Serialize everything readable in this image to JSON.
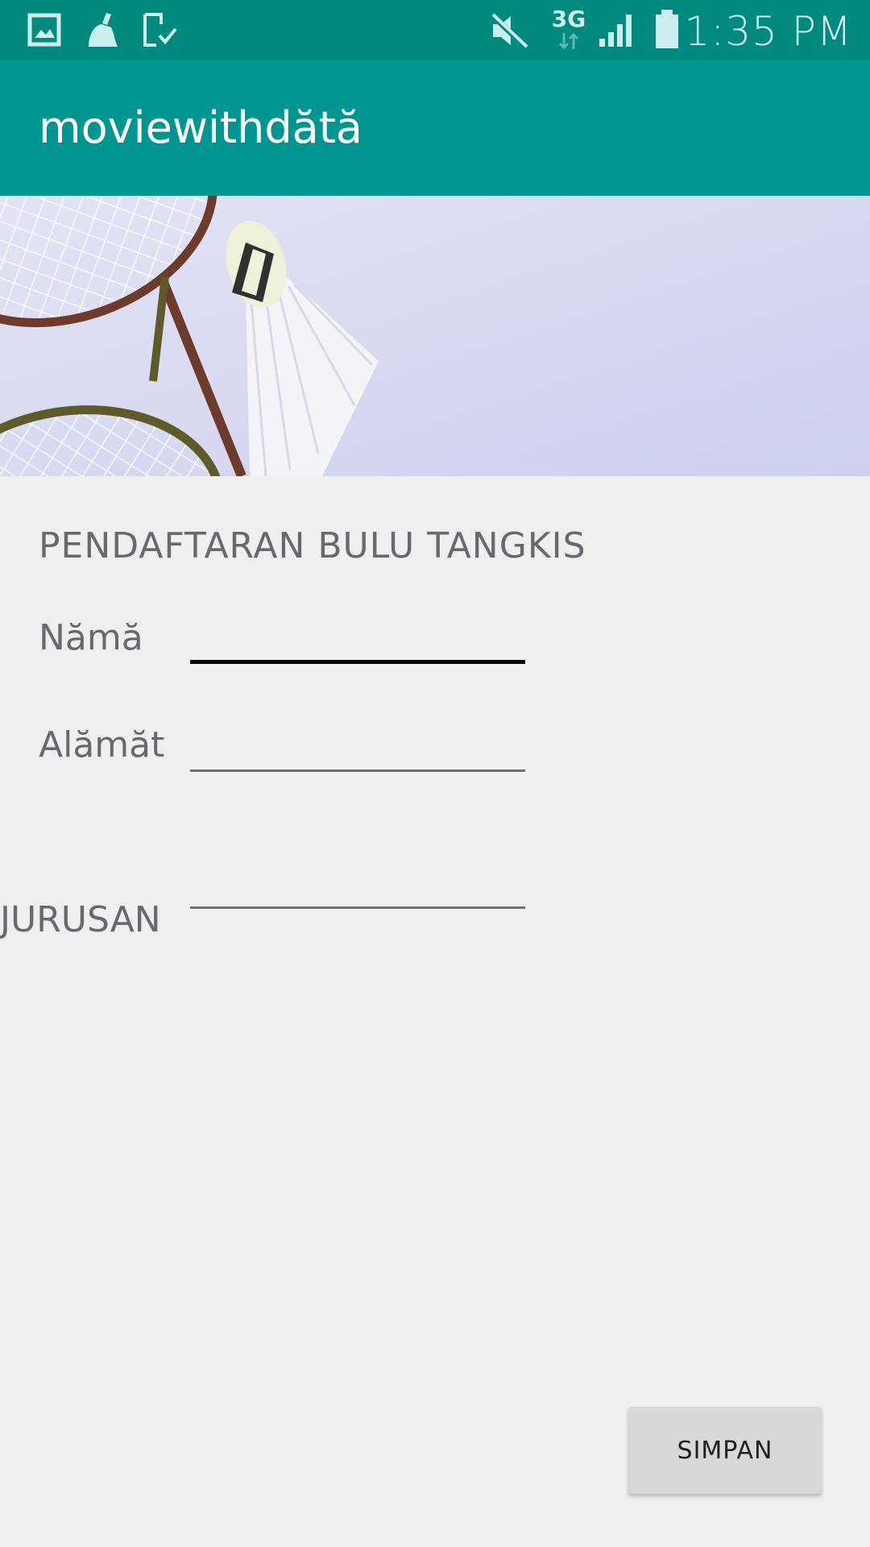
{
  "status_bar": {
    "time": "1:35 PM",
    "network": "3G",
    "icons": [
      "gallery-icon",
      "cleaner-icon",
      "download-done-icon",
      "mute-icon",
      "network-3g-icon",
      "signal-icon",
      "battery-icon"
    ]
  },
  "app_bar": {
    "title": "moviewithdătă",
    "color": "#009590"
  },
  "banner": {
    "background": "#d6d8ef",
    "subject": "badminton rackets and shuttlecock"
  },
  "form": {
    "title": "PENDAFTARAN BULU TANGKIS",
    "fields": [
      {
        "label": "Nămă",
        "value": "",
        "focused": true
      },
      {
        "label": "Alămăt",
        "value": ""
      },
      {
        "label": "JURUSAN",
        "value": ""
      }
    ],
    "save_label": "SIMPAN"
  },
  "colors": {
    "status_bar": "#00897f",
    "background": "#efeff0",
    "text": "#666a6e",
    "button": "#d7d8d8"
  }
}
